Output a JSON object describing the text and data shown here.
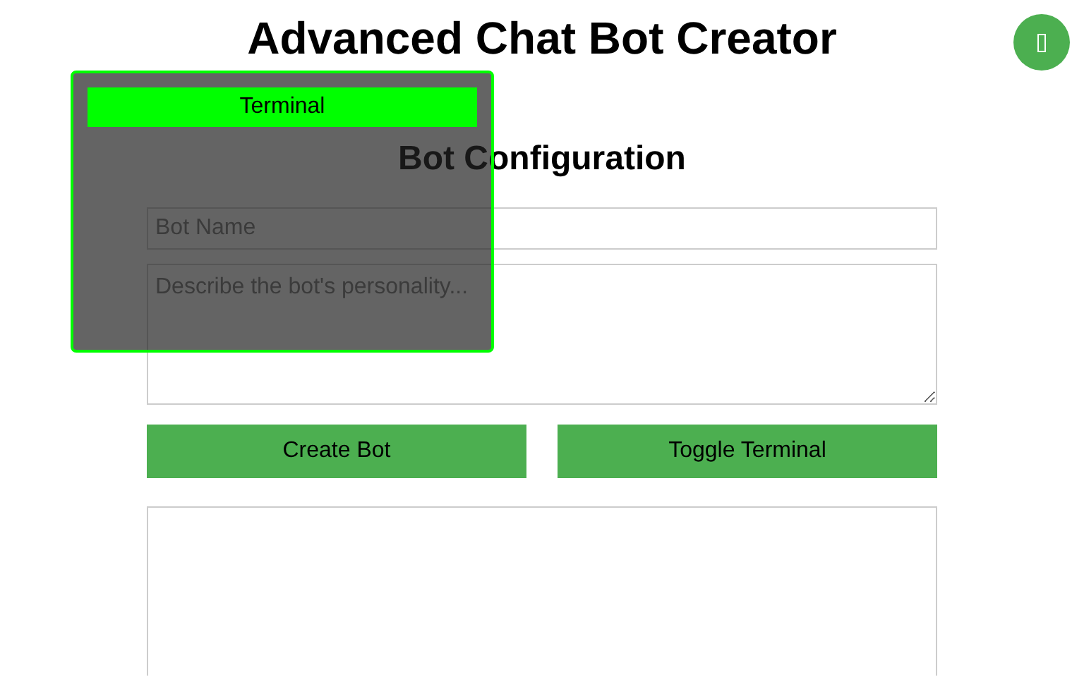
{
  "title": "Advanced Chat Bot Creator",
  "section_title": "Bot Configuration",
  "bot_name": {
    "placeholder": "Bot Name"
  },
  "personality": {
    "placeholder": "Describe the bot's personality..."
  },
  "buttons": [
    "Create Bot",
    "Toggle Terminal"
  ],
  "terminal": {
    "title": "Terminal"
  }
}
